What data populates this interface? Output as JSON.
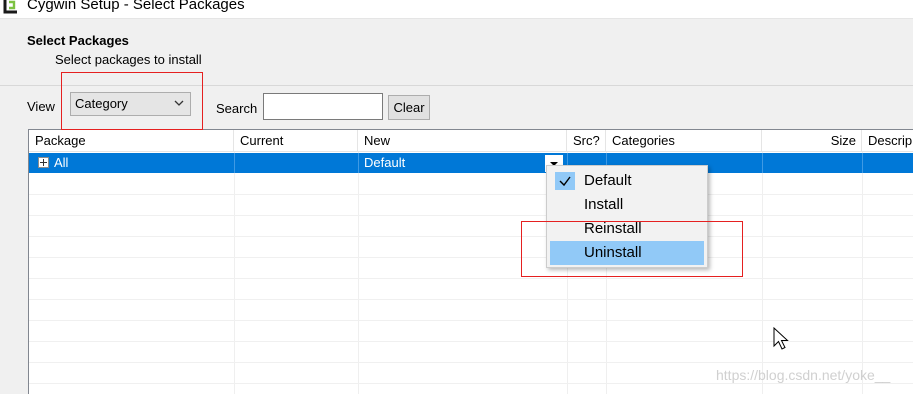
{
  "window": {
    "title": "Cygwin Setup - Select Packages"
  },
  "header": {
    "title": "Select Packages",
    "subtitle": "Select packages to install"
  },
  "toolbar": {
    "view_label": "View",
    "view_value": "Category",
    "search_label": "Search",
    "search_value": "",
    "clear_label": "Clear"
  },
  "grid": {
    "columns": [
      "Package",
      "Current",
      "New",
      "Src?",
      "Categories",
      "Size",
      "Descrip"
    ],
    "rows": [
      {
        "package": "All",
        "current": "",
        "new": "Default",
        "src": "",
        "categories": "",
        "size": "",
        "description": ""
      }
    ]
  },
  "dropdown_menu": {
    "items": [
      {
        "label": "Default",
        "checked": true
      },
      {
        "label": "Install",
        "checked": false
      },
      {
        "label": "Reinstall",
        "checked": false
      },
      {
        "label": "Uninstall",
        "highlighted": true
      }
    ]
  },
  "watermark": "https://blog.csdn.net/yoke__",
  "colors": {
    "selection": "#0078d7",
    "menu_highlight": "#91c9f7",
    "annotation": "#e52020"
  }
}
